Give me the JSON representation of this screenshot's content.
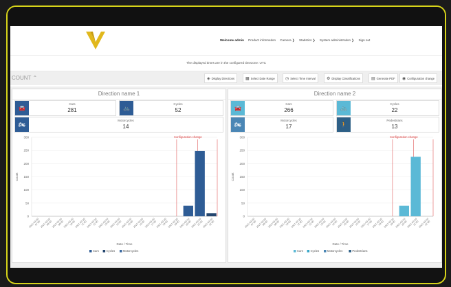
{
  "nav": {
    "welcome": "Welcome admin",
    "links": [
      "Product information",
      "Camera ❯",
      "Statistics ❯",
      "System administration ❯",
      "Sign out"
    ]
  },
  "timezone_notice": "The displayed times are in the configured timezone: UTC",
  "toolbar": {
    "count_label": "COUNT ⌃",
    "buttons": [
      {
        "label": "Display Directions",
        "icon": "compass-icon"
      },
      {
        "label": "Select Date Range",
        "icon": "calendar-icon"
      },
      {
        "label": "Select Time Interval",
        "icon": "clock-icon"
      },
      {
        "label": "Display Classifications",
        "icon": "classification-icon"
      },
      {
        "label": "Generate PDF",
        "icon": "document-icon"
      },
      {
        "label": "Configuration change",
        "icon": "eye-icon"
      }
    ]
  },
  "panels": [
    {
      "title": "Direction name 1",
      "accent": "#2e5c95",
      "cards": [
        {
          "label": "Cars",
          "value": "281",
          "icon": "car-icon"
        },
        {
          "label": "Cycles",
          "value": "52",
          "icon": "bicycle-icon"
        },
        {
          "label": "Motorcycles",
          "value": "14",
          "icon": "motorcycle-icon"
        }
      ],
      "chart_data": {
        "type": "bar",
        "xlabel": "Date / Time",
        "ylabel": "Count",
        "ylim": [
          0,
          300
        ],
        "yticks": [
          0,
          50,
          100,
          150,
          200,
          250,
          300
        ],
        "x_tick_labels": [
          "2021-03-20 07:00",
          "2021-03-20 08:00",
          "2021-03-20 09:00",
          "2021-03-20 10:00",
          "2021-03-20 11:00",
          "2021-03-20 12:00",
          "2021-03-20 13:00",
          "2021-03-20 14:00",
          "2021-03-20 15:00",
          "2021-03-20 16:00",
          "2021-03-20 17:00",
          "2021-03-20 18:00",
          "2021-03-20 19:00",
          "2021-03-20 20:00",
          "2021-03-20 21:00",
          "2021-03-20 22:00"
        ],
        "series": [
          {
            "name": "Cars",
            "color": "#2e5c95",
            "values": [
              0,
              0,
              0,
              0,
              0,
              0,
              0,
              0,
              0,
              0,
              0,
              0,
              0,
              40,
              248,
              0
            ]
          },
          {
            "name": "Cycles",
            "color": "#24466f",
            "values": [
              0,
              0,
              0,
              0,
              0,
              0,
              0,
              0,
              0,
              0,
              0,
              0,
              0,
              0,
              0,
              12
            ]
          },
          {
            "name": "Motorcycles",
            "color": "#3c6aa0",
            "values": [
              0,
              0,
              0,
              0,
              0,
              0,
              0,
              0,
              0,
              0,
              0,
              0,
              0,
              0,
              0,
              0
            ]
          }
        ],
        "annotation": {
          "label": "Configuration change",
          "color": "#d93a3a",
          "x_index": 12
        }
      }
    },
    {
      "title": "Direction name 2",
      "accent": "#5bb9d6",
      "cards": [
        {
          "label": "Cars",
          "value": "266",
          "icon": "car-icon"
        },
        {
          "label": "Cycles",
          "value": "22",
          "icon": "bicycle-icon"
        },
        {
          "label": "Motorcycles",
          "value": "17",
          "icon": "motorcycle-icon"
        },
        {
          "label": "Pedestrians",
          "value": "13",
          "icon": "pedestrian-icon"
        }
      ],
      "chart_data": {
        "type": "bar",
        "xlabel": "Date / Time",
        "ylabel": "Count",
        "ylim": [
          0,
          300
        ],
        "yticks": [
          0,
          50,
          100,
          150,
          200,
          250,
          300
        ],
        "x_tick_labels": [
          "2021-03-20 07:00",
          "2021-03-20 08:00",
          "2021-03-20 09:00",
          "2021-03-20 10:00",
          "2021-03-20 11:00",
          "2021-03-20 12:00",
          "2021-03-20 13:00",
          "2021-03-20 14:00",
          "2021-03-20 15:00",
          "2021-03-20 16:00",
          "2021-03-20 17:00",
          "2021-03-20 18:00",
          "2021-03-20 19:00",
          "2021-03-20 20:00",
          "2021-03-20 21:00",
          "2021-03-20 22:00"
        ],
        "series": [
          {
            "name": "Cars",
            "color": "#5bb9d6",
            "values": [
              0,
              0,
              0,
              0,
              0,
              0,
              0,
              0,
              0,
              0,
              0,
              0,
              0,
              40,
              226,
              0
            ]
          },
          {
            "name": "Cycles",
            "color": "#3aa7c8",
            "values": [
              0,
              0,
              0,
              0,
              0,
              0,
              0,
              0,
              0,
              0,
              0,
              0,
              0,
              0,
              0,
              0
            ]
          },
          {
            "name": "Motorcycles",
            "color": "#4a86b5",
            "values": [
              0,
              0,
              0,
              0,
              0,
              0,
              0,
              0,
              0,
              0,
              0,
              0,
              0,
              0,
              0,
              0
            ]
          },
          {
            "name": "Pedestrians",
            "color": "#2d5f86",
            "values": [
              0,
              0,
              0,
              0,
              0,
              0,
              0,
              0,
              0,
              0,
              0,
              0,
              0,
              0,
              0,
              0
            ]
          }
        ],
        "annotation": {
          "label": "Configuration change",
          "color": "#d93a3a",
          "x_index": 12
        }
      }
    }
  ]
}
